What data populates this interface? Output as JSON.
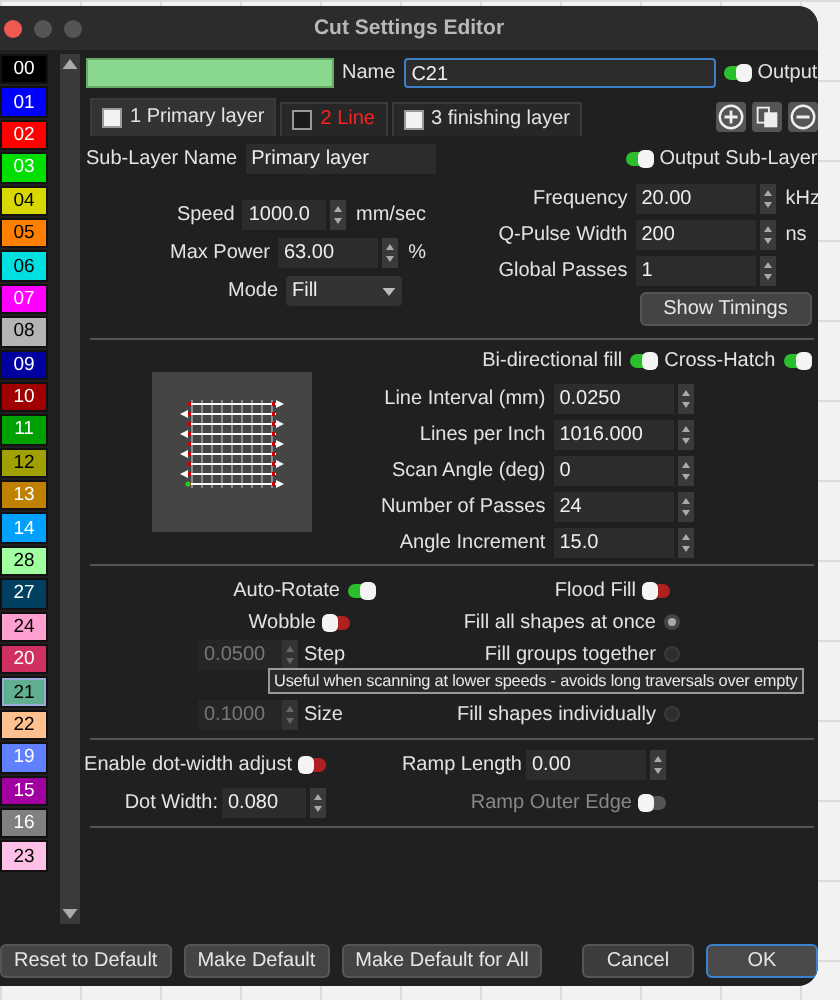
{
  "window": {
    "title": "Cut Settings Editor"
  },
  "layers": [
    {
      "label": "00",
      "color": "#000000",
      "selected": false
    },
    {
      "label": "01",
      "color": "#0000ff",
      "selected": false
    },
    {
      "label": "02",
      "color": "#ff0000",
      "selected": false
    },
    {
      "label": "03",
      "color": "#00e000",
      "selected": false
    },
    {
      "label": "04",
      "color": "#d8d800",
      "selected": false
    },
    {
      "label": "05",
      "color": "#ff8000",
      "selected": false
    },
    {
      "label": "06",
      "color": "#00e0e0",
      "selected": false
    },
    {
      "label": "07",
      "color": "#ff00ff",
      "selected": false
    },
    {
      "label": "08",
      "color": "#b4b4b4",
      "selected": false
    },
    {
      "label": "09",
      "color": "#0000a0",
      "selected": false
    },
    {
      "label": "10",
      "color": "#a00000",
      "selected": false
    },
    {
      "label": "11",
      "color": "#00a000",
      "selected": false
    },
    {
      "label": "12",
      "color": "#a0a000",
      "selected": false
    },
    {
      "label": "13",
      "color": "#c08000",
      "selected": false
    },
    {
      "label": "14",
      "color": "#00a0ff",
      "selected": false
    },
    {
      "label": "28",
      "color": "#a0ffa0",
      "selected": false
    },
    {
      "label": "27",
      "color": "#004060",
      "selected": false
    },
    {
      "label": "24",
      "color": "#ffa0d0",
      "selected": false
    },
    {
      "label": "20",
      "color": "#d03060",
      "selected": false
    },
    {
      "label": "21",
      "color": "#60b090",
      "selected": true
    },
    {
      "label": "22",
      "color": "#ffc090",
      "selected": false
    },
    {
      "label": "19",
      "color": "#6080ff",
      "selected": false
    },
    {
      "label": "15",
      "color": "#a000a0",
      "selected": false
    },
    {
      "label": "16",
      "color": "#808080",
      "selected": false
    },
    {
      "label": "23",
      "color": "#ffc0e8",
      "selected": false
    }
  ],
  "name_field": {
    "label": "Name",
    "value": "C21"
  },
  "output": {
    "label": "Output",
    "on": true
  },
  "sublayer_tabs": [
    {
      "label": "1 Primary layer",
      "kind": "fill",
      "selected": true
    },
    {
      "label": "2 Line",
      "kind": "line",
      "selected": false
    },
    {
      "label": "3 finishing layer",
      "kind": "fill",
      "selected": false
    }
  ],
  "sublayer_name": {
    "label": "Sub-Layer Name",
    "value": "Primary layer"
  },
  "output_sublayer": {
    "label": "Output Sub-Layer",
    "on": true
  },
  "left_fields": [
    {
      "label": "Speed",
      "value": "1000.0",
      "unit": "mm/sec",
      "kind": "spin"
    },
    {
      "label": "Max Power",
      "value": "63.00",
      "unit": "%",
      "kind": "spin"
    },
    {
      "label": "Mode",
      "value": "Fill",
      "kind": "dropdown"
    }
  ],
  "right_fields": [
    {
      "label": "Frequency",
      "value": "20.00",
      "unit": "kHz"
    },
    {
      "label": "Q-Pulse Width",
      "value": "200",
      "unit": "ns"
    },
    {
      "label": "Global Passes",
      "value": "1"
    }
  ],
  "show_timings": "Show Timings",
  "fill_toggles": [
    {
      "label": "Bi-directional fill",
      "on": true
    },
    {
      "label": "Cross-Hatch",
      "on": true
    }
  ],
  "fill_fields": [
    {
      "label": "Line Interval (mm)",
      "value": "0.0250"
    },
    {
      "label": "Lines per Inch",
      "value": "1016.000"
    },
    {
      "label": "Scan Angle (deg)",
      "value": "0"
    },
    {
      "label": "Number of Passes",
      "value": "24"
    },
    {
      "label": "Angle Increment",
      "value": "15.0"
    }
  ],
  "auto_rotate": {
    "label": "Auto-Rotate",
    "on": true
  },
  "flood_fill": {
    "label": "Flood Fill",
    "on": false
  },
  "wobble": {
    "label": "Wobble",
    "on": false
  },
  "wobble_fields": [
    {
      "label": "Step",
      "value": "0.0500",
      "disabled": true
    },
    {
      "label": "Size",
      "value": "0.1000",
      "disabled": true
    }
  ],
  "fill_order": [
    {
      "label": "Fill all shapes at once",
      "selected": true
    },
    {
      "label": "Fill groups together",
      "selected": false
    },
    {
      "label": "Fill shapes individually",
      "selected": false
    }
  ],
  "tooltip": "Useful when scanning at lower speeds - avoids long traversals over empty",
  "dot_width_adjust": {
    "label": "Enable dot-width adjust",
    "on": false
  },
  "ramp_length": {
    "label": "Ramp Length",
    "value": "0.00"
  },
  "dot_width": {
    "label": "Dot Width:",
    "value": "0.080"
  },
  "ramp_outer_edge": {
    "label": "Ramp Outer Edge",
    "on": false,
    "disabled": true
  },
  "buttons": [
    {
      "label": "Reset to Default",
      "kind": "left"
    },
    {
      "label": "Make Default",
      "kind": "left"
    },
    {
      "label": "Make Default for All",
      "kind": "left"
    },
    {
      "label": "Cancel",
      "kind": "right"
    },
    {
      "label": "OK",
      "kind": "default"
    }
  ]
}
